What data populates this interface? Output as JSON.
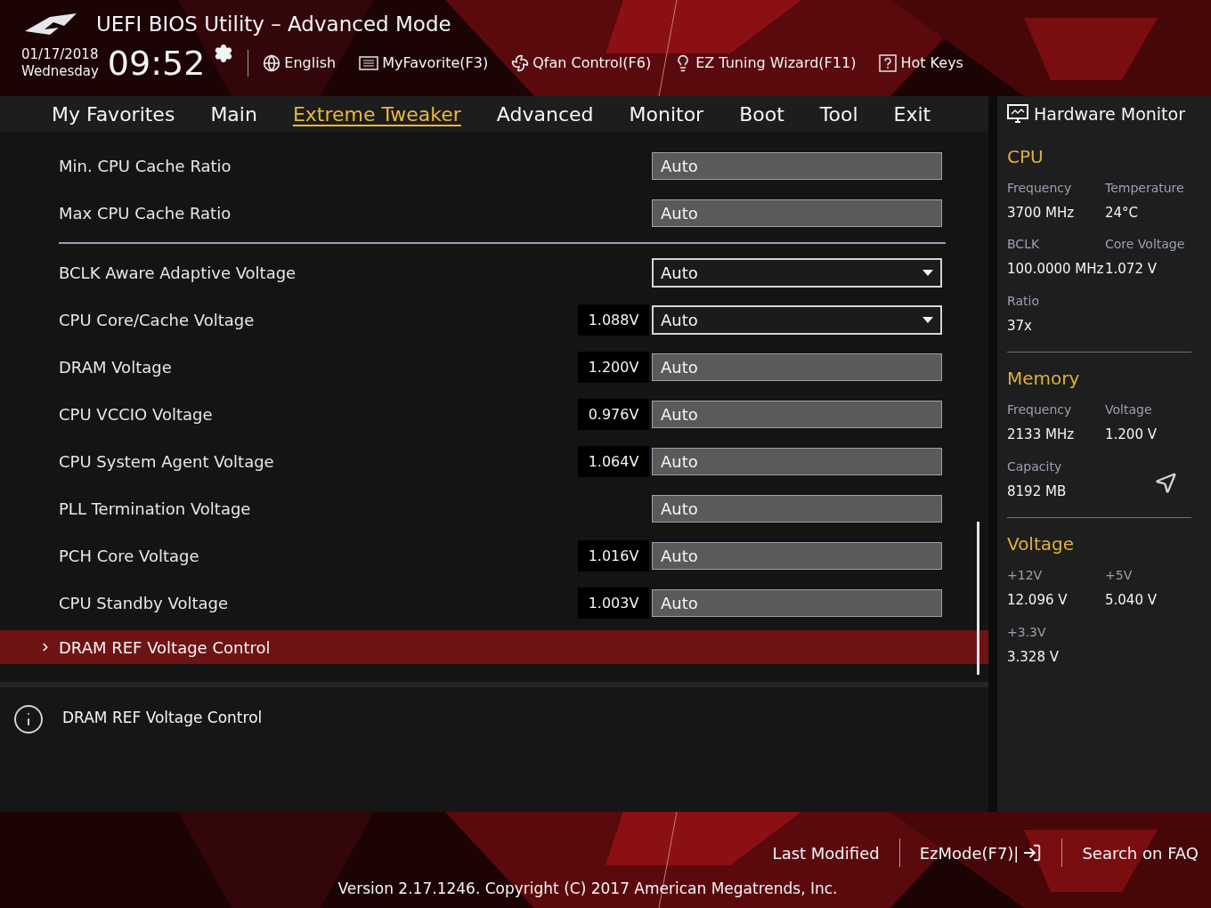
{
  "header": {
    "title": "UEFI BIOS Utility – Advanced Mode",
    "date": "01/17/2018",
    "weekday": "Wednesday",
    "time": "09:52",
    "tools": [
      {
        "kind": "globe",
        "label": "English"
      },
      {
        "kind": "favorite",
        "label": "MyFavorite(F3)"
      },
      {
        "kind": "fan",
        "label": "Qfan Control(F6)"
      },
      {
        "kind": "bulb",
        "label": "EZ Tuning Wizard(F11)"
      },
      {
        "kind": "help",
        "label": "Hot Keys"
      }
    ]
  },
  "tabs": [
    {
      "label": "My Favorites",
      "selected": false
    },
    {
      "label": "Main",
      "selected": false
    },
    {
      "label": "Extreme Tweaker",
      "selected": true
    },
    {
      "label": "Advanced",
      "selected": false
    },
    {
      "label": "Monitor",
      "selected": false
    },
    {
      "label": "Boot",
      "selected": false
    },
    {
      "label": "Tool",
      "selected": false
    },
    {
      "label": "Exit",
      "selected": false
    }
  ],
  "sections": [
    [
      {
        "label": "Min. CPU Cache Ratio",
        "kind": "field",
        "value": "Auto"
      },
      {
        "label": "Max CPU Cache Ratio",
        "kind": "field",
        "value": "Auto"
      }
    ],
    [
      {
        "label": "BCLK Aware Adaptive Voltage",
        "kind": "dropdown",
        "value": "Auto"
      },
      {
        "label": "CPU Core/Cache Voltage",
        "kind": "dropdown",
        "reading": "1.088V",
        "value": "Auto"
      },
      {
        "label": "DRAM Voltage",
        "kind": "field",
        "reading": "1.200V",
        "value": "Auto"
      },
      {
        "label": "CPU VCCIO Voltage",
        "kind": "field",
        "reading": "0.976V",
        "value": "Auto"
      },
      {
        "label": "CPU System Agent Voltage",
        "kind": "field",
        "reading": "1.064V",
        "value": "Auto"
      },
      {
        "label": "PLL Termination Voltage",
        "kind": "field",
        "value": "Auto"
      },
      {
        "label": "PCH Core Voltage",
        "kind": "field",
        "reading": "1.016V",
        "value": "Auto"
      },
      {
        "label": "CPU Standby Voltage",
        "kind": "field",
        "reading": "1.003V",
        "value": "Auto"
      },
      {
        "label": "DRAM REF Voltage Control",
        "kind": "submenu",
        "selected": true
      }
    ]
  ],
  "help": "DRAM REF Voltage Control",
  "monitor": {
    "title": "Hardware Monitor",
    "groups": [
      {
        "title": "CPU",
        "items": [
          {
            "label": "Frequency",
            "value": "3700 MHz"
          },
          {
            "label": "Temperature",
            "value": "24°C"
          },
          {
            "label": "BCLK",
            "value": "100.0000 MHz"
          },
          {
            "label": "Core Voltage",
            "value": "1.072 V"
          },
          {
            "label": "Ratio",
            "value": "37x"
          }
        ]
      },
      {
        "title": "Memory",
        "items": [
          {
            "label": "Frequency",
            "value": "2133 MHz"
          },
          {
            "label": "Voltage",
            "value": "1.200 V"
          },
          {
            "label": "Capacity",
            "value": "8192 MB"
          }
        ]
      },
      {
        "title": "Voltage",
        "items": [
          {
            "label": "+12V",
            "value": "12.096 V"
          },
          {
            "label": "+5V",
            "value": "5.040 V"
          },
          {
            "label": "+3.3V",
            "value": "3.328 V"
          }
        ]
      }
    ]
  },
  "footer": {
    "links": [
      {
        "kind": "plain",
        "label": "Last Modified"
      },
      {
        "kind": "exit",
        "label": "EzMode(F7)|"
      },
      {
        "kind": "plain",
        "label": "Search on FAQ"
      }
    ],
    "version": "Version 2.17.1246. Copyright (C) 2017 American Megatrends, Inc."
  }
}
